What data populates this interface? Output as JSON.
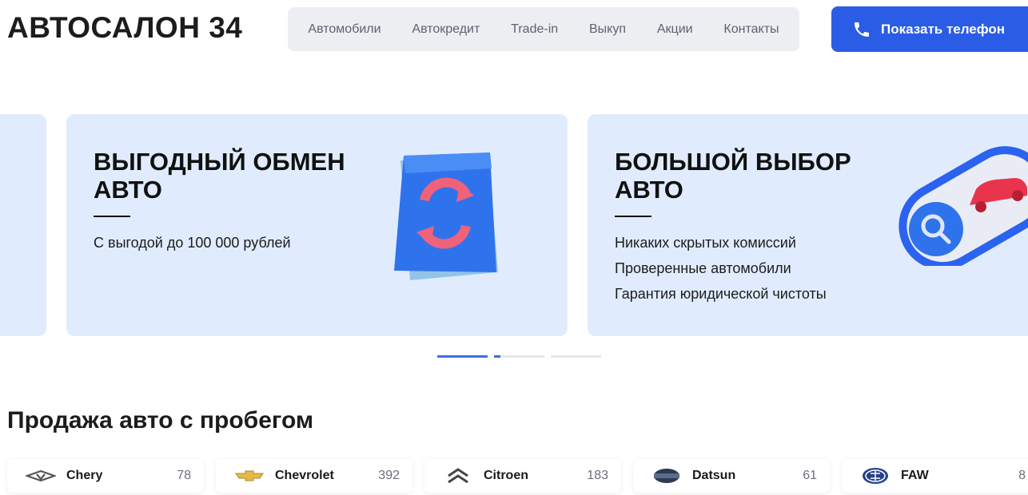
{
  "header": {
    "logo": "АВТОСАЛОН 34",
    "nav": [
      "Автомобили",
      "Автокредит",
      "Trade-in",
      "Выкуп",
      "Акции",
      "Контакты"
    ],
    "phone_button": "Показать телефон"
  },
  "slider": {
    "slides": [
      {
        "title_line1": "ВЫГОДНЫЙ ОБМЕН",
        "title_line2": "АВТО",
        "lines": [
          "С выгодой до 100 000 рублей"
        ]
      },
      {
        "title_line1": "БОЛЬШОЙ ВЫБОР",
        "title_line2": "АВТО",
        "lines": [
          "Никаких скрытых комиссий",
          "Проверенные автомобили",
          "Гарантия юридической чистоты"
        ]
      }
    ]
  },
  "section": {
    "title": "Продажа авто с пробегом",
    "brands": [
      {
        "name": "Chery",
        "count": "78",
        "icon": "chery-logo-icon"
      },
      {
        "name": "Chevrolet",
        "count": "392",
        "icon": "chevrolet-logo-icon"
      },
      {
        "name": "Citroen",
        "count": "183",
        "icon": "citroen-logo-icon"
      },
      {
        "name": "Datsun",
        "count": "61",
        "icon": "datsun-logo-icon"
      },
      {
        "name": "FAW",
        "count": "8",
        "icon": "faw-logo-icon"
      }
    ]
  },
  "colors": {
    "accent": "#2b5ce6",
    "slide_bg": "#e0ecfd",
    "nav_bg": "#eceef2"
  }
}
